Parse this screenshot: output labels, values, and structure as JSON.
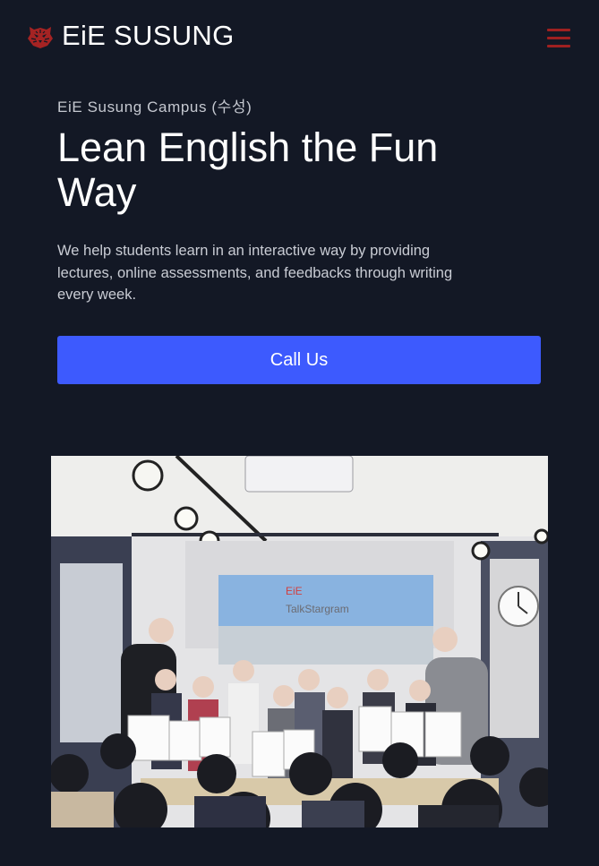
{
  "header": {
    "logo_icon": "tiger-head-icon",
    "logo_text": "EiE SUSUNG",
    "menu_icon": "hamburger-menu-icon",
    "accent_color": "#9f2020"
  },
  "hero": {
    "eyebrow": "EiE Susung Campus (수성)",
    "title": "Lean English the Fun Way",
    "description": "We help students learn in an interactive way by providing lectures, online assessments, and feedbacks through writing every week.",
    "cta_label": "Call Us",
    "cta_color": "#3d5afe"
  },
  "photo": {
    "screen_text_1": "EiE",
    "screen_text_2": "TalkStargram"
  },
  "colors": {
    "background": "#131825",
    "text": "#ffffff",
    "muted_text": "#c9ccd4"
  }
}
